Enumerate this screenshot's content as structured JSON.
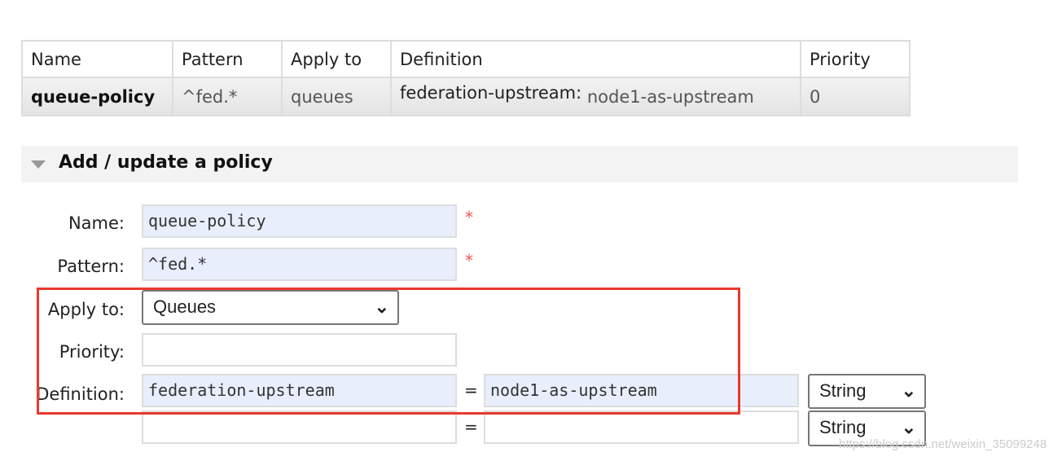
{
  "policies_table": {
    "headers": [
      "Name",
      "Pattern",
      "Apply to",
      "Definition",
      "Priority"
    ],
    "rows": [
      {
        "name": "queue-policy",
        "pattern": "^fed.*",
        "apply_to": "queues",
        "definition_key": "federation-upstream:",
        "definition_value": "node1-as-upstream",
        "priority": "0"
      }
    ]
  },
  "section": {
    "title": "Add / update a policy"
  },
  "form": {
    "name_label": "Name:",
    "name_value": "queue-policy",
    "pattern_label": "Pattern:",
    "pattern_value": "^fed.*",
    "required_mark": "*",
    "apply_label": "Apply to:",
    "apply_value": "Queues",
    "priority_label": "Priority:",
    "priority_value": "",
    "definition_label": "Definition:",
    "definitions": [
      {
        "key": "federation-upstream",
        "value": "node1-as-upstream",
        "type": "String"
      },
      {
        "key": "",
        "value": "",
        "type": "String"
      }
    ],
    "equals": "="
  },
  "highlight_color": "#e8392f",
  "watermark": "https://blog.csdn.net/weixin_35099248"
}
